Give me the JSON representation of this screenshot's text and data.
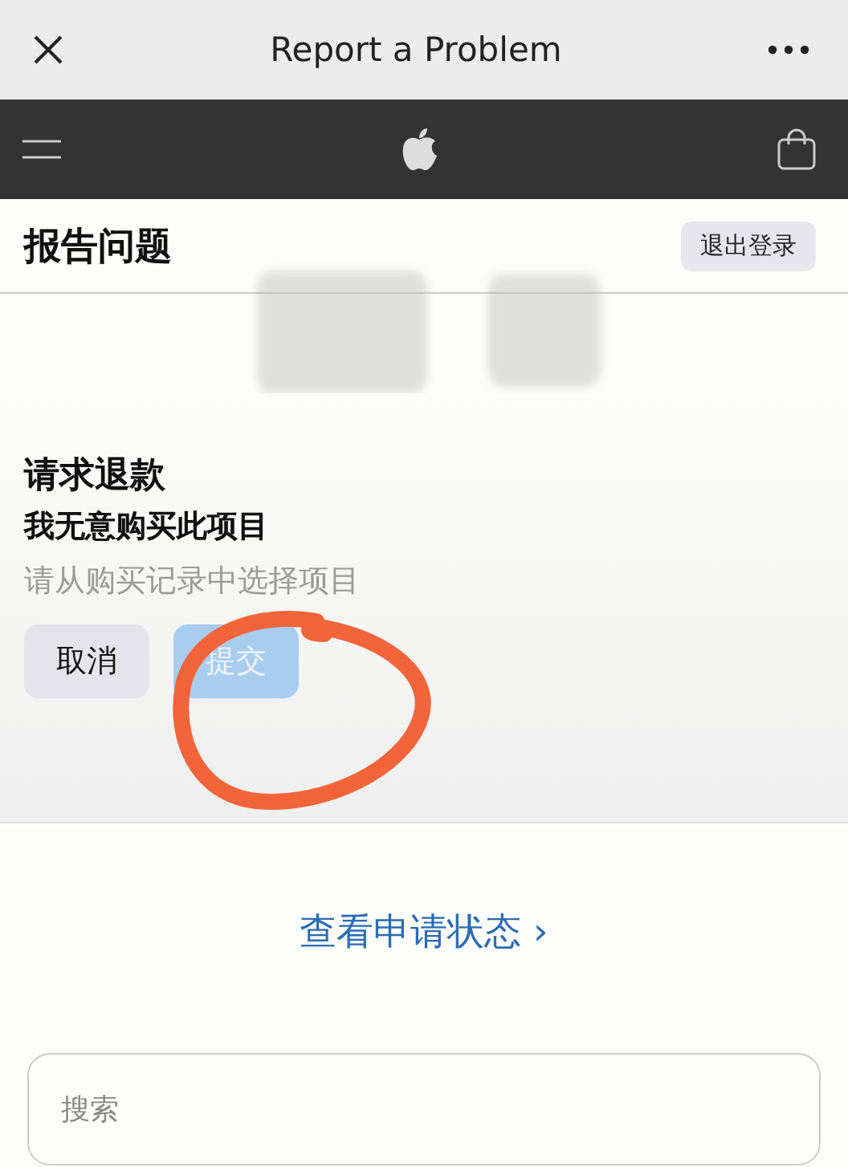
{
  "browser_bar": {
    "title": "Report a Problem"
  },
  "page": {
    "heading": "报告问题",
    "sign_out_button": "退出登录"
  },
  "refund": {
    "title": "请求退款",
    "reason": "我无意购买此项目",
    "hint": "请从购买记录中选择项目",
    "buttons": [
      {
        "label": "取消",
        "kind": "cancel",
        "disabled": false
      },
      {
        "label": "提交",
        "kind": "submit",
        "disabled": true
      }
    ]
  },
  "status_link": "查看申请状态 ›",
  "search": {
    "placeholder": "搜索"
  }
}
